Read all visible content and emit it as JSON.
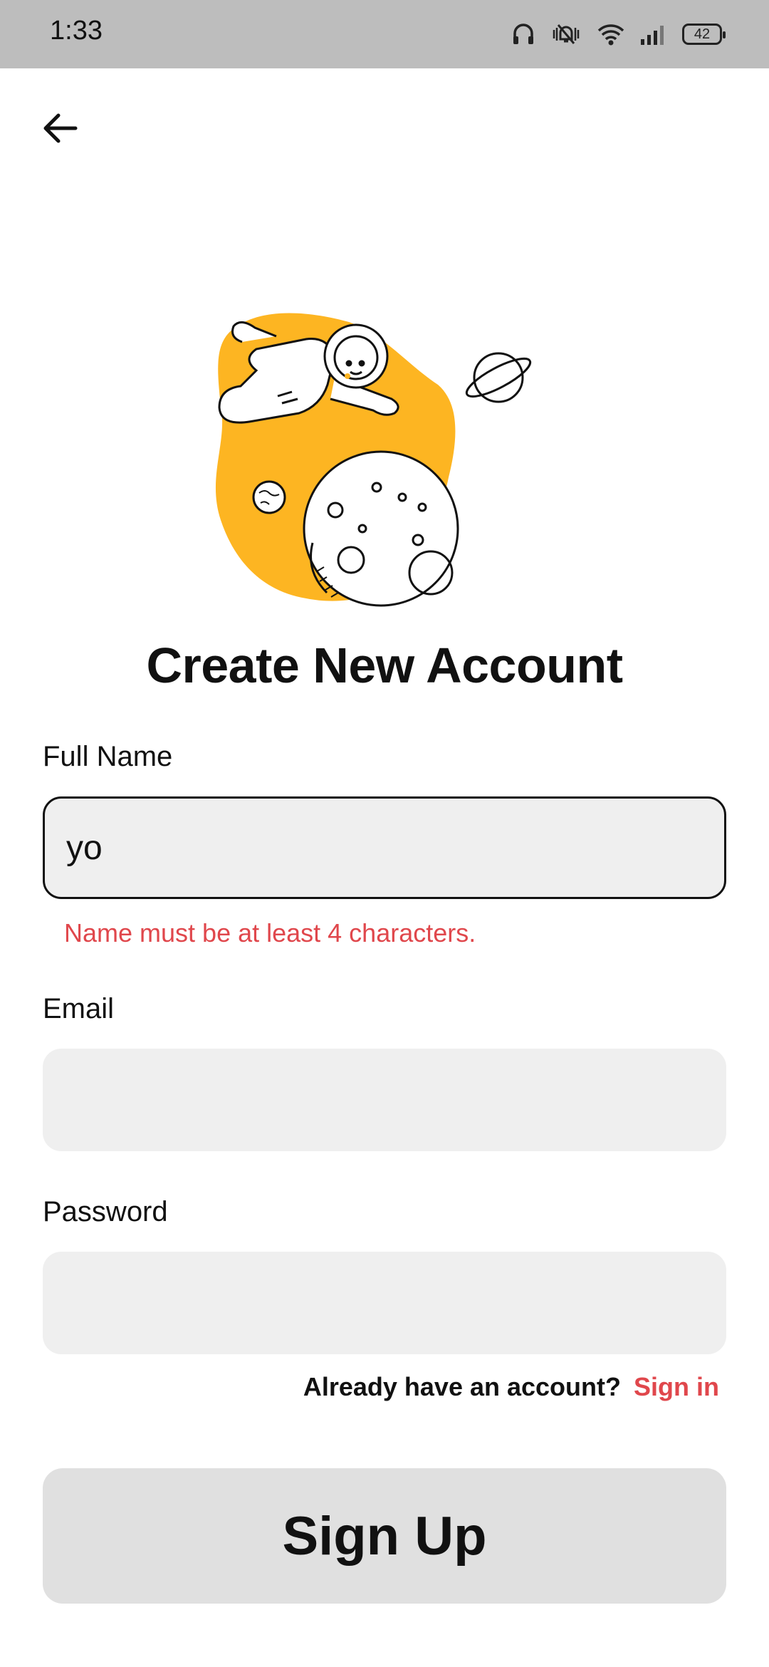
{
  "status_bar": {
    "time": "1:33",
    "battery": "42",
    "icons": [
      "headphones-icon",
      "vibrate-mute-icon",
      "wifi-icon",
      "signal-icon",
      "battery-icon"
    ]
  },
  "nav": {
    "back_icon": "arrow-left-icon"
  },
  "illustration": {
    "name": "astronaut-space-illustration",
    "accent_color": "#fdb522"
  },
  "title": "Create New Account",
  "form": {
    "name_label": "Full Name",
    "name_value": "yo",
    "name_error": "Name must be at least 4 characters.",
    "email_label": "Email",
    "email_value": "",
    "password_label": "Password",
    "password_value": ""
  },
  "signin": {
    "question": "Already have an account?",
    "link": "Sign in"
  },
  "signup_button": "Sign Up",
  "colors": {
    "error": "#e0474c",
    "field_bg": "#efefef",
    "button_bg": "#e0e0e0",
    "status_bar_bg": "#bdbdbd"
  }
}
